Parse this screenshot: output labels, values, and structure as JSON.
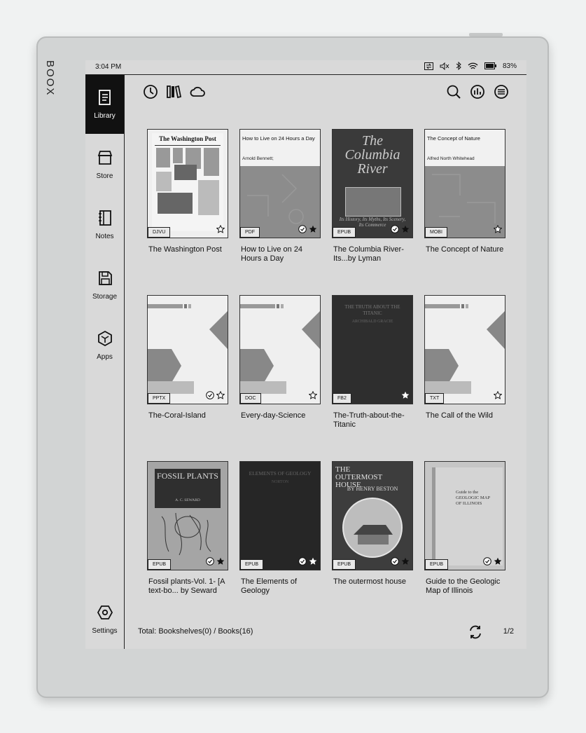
{
  "device": {
    "brand": "BOOX"
  },
  "status_bar": {
    "time": "3:04 PM",
    "battery": "83%"
  },
  "sidebar": {
    "items": [
      {
        "label": "Library",
        "icon": "library-icon",
        "active": true
      },
      {
        "label": "Store",
        "icon": "store-icon"
      },
      {
        "label": "Notes",
        "icon": "notes-icon"
      },
      {
        "label": "Storage",
        "icon": "storage-icon"
      },
      {
        "label": "Apps",
        "icon": "apps-icon"
      },
      {
        "label": "Settings",
        "icon": "settings-icon"
      }
    ]
  },
  "toolbar": {
    "left_icons": [
      "recent-icon",
      "bookshelf-icon",
      "cloud-icon"
    ],
    "right_icons": [
      "search-icon",
      "stats-icon",
      "menu-icon"
    ]
  },
  "books": [
    {
      "title": "The Washington Post",
      "format": "DJVU",
      "cover_text": "The Washington Post",
      "author_text": "",
      "checked": false,
      "starred": false
    },
    {
      "title": "How to Live on 24 Hours a Day",
      "format": "PDF",
      "cover_text": "How to Live on 24 Hours a Day",
      "author_text": "Arnold Bennett;",
      "checked": true,
      "starred": true
    },
    {
      "title": "The Columbia River-Its...by Lyman",
      "format": "EPUB",
      "cover_text": "The Columbia River",
      "author_text": "Its History, Its Myths, Its Scenery, Its Commerce",
      "checked": true,
      "starred": true
    },
    {
      "title": "The Concept of Nature",
      "format": "MOBI",
      "cover_text": "The Concept of Nature",
      "author_text": "Alfred North Whitehead",
      "checked": false,
      "starred": false
    },
    {
      "title": "The-Coral-Island",
      "format": "PPTX",
      "cover_text": "",
      "author_text": "",
      "checked": true,
      "starred": false
    },
    {
      "title": "Every-day-Science",
      "format": "DOC",
      "cover_text": "",
      "author_text": "",
      "checked": false,
      "starred": false
    },
    {
      "title": "The-Truth-about-the-Titanic",
      "format": "FB2",
      "cover_text": "THE TRUTH ABOUT THE TITANIC",
      "author_text": "ARCHIBALD GRACIE",
      "checked": false,
      "starred": true
    },
    {
      "title": "The Call of the Wild",
      "format": "TXT",
      "cover_text": "",
      "author_text": "",
      "checked": false,
      "starred": false
    },
    {
      "title": "Fossil plants-Vol. 1- [A text-bo... by Seward",
      "format": "EPUB",
      "cover_text": "FOSSIL PLANTS",
      "author_text": "A. C. SEWARD",
      "checked": true,
      "starred": true
    },
    {
      "title": "The Elements of Geology",
      "format": "EPUB",
      "cover_text": "ELEMENTS OF GEOLOGY",
      "author_text": "NORTON",
      "checked": true,
      "starred": true
    },
    {
      "title": "The outermost house",
      "format": "EPUB",
      "cover_text": "THE OUTERMOST HOUSE",
      "author_text": "BY HENRY BESTON",
      "checked": true,
      "starred": true
    },
    {
      "title": "Guide to the Geologic Map of Illinois",
      "format": "EPUB",
      "cover_text": "Guide to the GEOLOGIC MAP OF ILLINOIS",
      "author_text": "",
      "checked": true,
      "starred": true
    }
  ],
  "footer": {
    "total": "Total: Bookshelves(0) / Books(16)",
    "page": "1/2"
  }
}
